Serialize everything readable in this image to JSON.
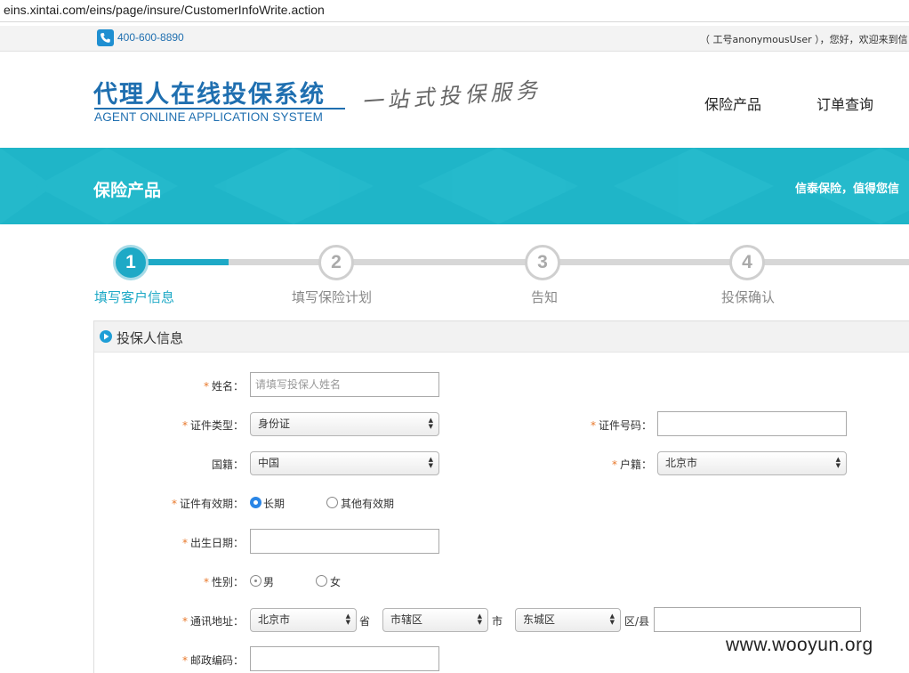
{
  "browser": {
    "url": "eins.xintai.com/eins/page/insure/CustomerInfoWrite.action"
  },
  "topbar": {
    "phone": "400-600-8890",
    "welcome": "（ 工号anonymousUser ），您好，欢迎来到信"
  },
  "header": {
    "logo_cn": "代理人在线投保系统",
    "logo_en": "AGENT ONLINE APPLICATION SYSTEM",
    "slogan": "一站式投保服务",
    "nav": [
      "保险产品",
      "订单查询"
    ]
  },
  "banner": {
    "title": "保险产品",
    "slogan": "信泰保险，值得您信"
  },
  "steps": [
    {
      "num": "1",
      "label": "填写客户信息",
      "active": true
    },
    {
      "num": "2",
      "label": "填写保险计划",
      "active": false
    },
    {
      "num": "3",
      "label": "告知",
      "active": false
    },
    {
      "num": "4",
      "label": "投保确认",
      "active": false
    }
  ],
  "panel": {
    "title": "投保人信息"
  },
  "form": {
    "name": {
      "label": "姓名：",
      "placeholder": "请填写投保人姓名"
    },
    "id_type": {
      "label": "证件类型：",
      "value": "身份证"
    },
    "id_number": {
      "label": "证件号码：",
      "value": ""
    },
    "nationality": {
      "label": "国籍：",
      "value": "中国"
    },
    "household": {
      "label": "户籍：",
      "value": "北京市"
    },
    "id_validity": {
      "label": "证件有效期：",
      "options": [
        "长期",
        "其他有效期"
      ],
      "selected": "长期"
    },
    "birth_date": {
      "label": "出生日期：",
      "value": ""
    },
    "gender": {
      "label": "性别：",
      "options": [
        "男",
        "女"
      ]
    },
    "address": {
      "label": "通讯地址：",
      "province": "北京市",
      "province_suffix": "省",
      "city": "市辖区",
      "city_suffix": "市",
      "district": "东城区",
      "district_suffix": "区/县",
      "detail": ""
    },
    "postcode": {
      "label": "邮政编码：",
      "value": ""
    }
  },
  "watermark": "www.wooyun.org",
  "colors": {
    "brand_blue": "#1f6fb0",
    "teal": "#1fb5c8",
    "step_active": "#1ea9c6",
    "required": "#e8782b"
  }
}
